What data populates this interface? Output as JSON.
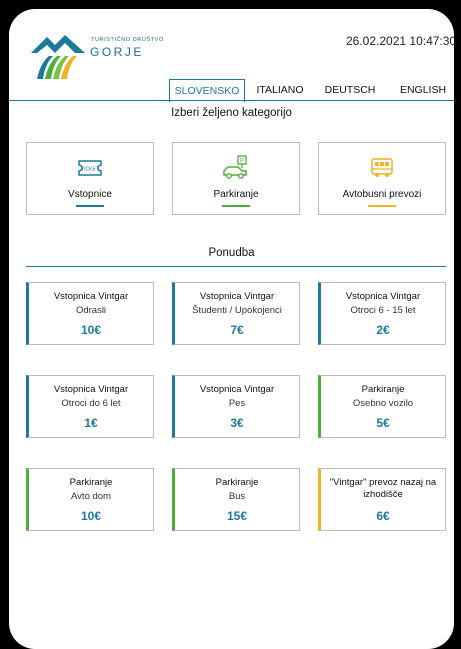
{
  "brand": {
    "small": "TURISTIČNO DRUŠTVO",
    "big": "GORJE"
  },
  "datetime": "26.02.2021  10:47:30",
  "tabs": [
    {
      "label": "SLOVENSKO",
      "active": true
    },
    {
      "label": "ITALIANO",
      "active": false
    },
    {
      "label": "DEUTSCH",
      "active": false
    },
    {
      "label": "ENGLISH",
      "active": false
    }
  ],
  "category_heading": "Izberi željeno kategorijo",
  "categories": [
    {
      "label": "Vstopnice",
      "icon": "ticket-icon",
      "color": "#1e7a99"
    },
    {
      "label": "Parkiranje",
      "icon": "car-parking-icon",
      "color": "#4caf3a"
    },
    {
      "label": "Avtobusni prevozi",
      "icon": "bus-icon",
      "color": "#f0b323"
    }
  ],
  "offers_heading": "Ponudba",
  "offers": [
    {
      "title": "Vstopnica Vintgar",
      "subtitle": "Odrasli",
      "price": "10€",
      "color": "#1e7a99"
    },
    {
      "title": "Vstopnica Vintgar",
      "subtitle": "Študenti / Upokojenci",
      "price": "7€",
      "color": "#1e7a99"
    },
    {
      "title": "Vstopnica Vintgar",
      "subtitle": "Otroci 6 - 15 let",
      "price": "2€",
      "color": "#1e7a99"
    },
    {
      "title": "Vstopnica Vintgar",
      "subtitle": "Otroci do 6 let",
      "price": "1€",
      "color": "#1e7a99"
    },
    {
      "title": "Vstopnica Vintgar",
      "subtitle": "Pes",
      "price": "3€",
      "color": "#1e7a99"
    },
    {
      "title": "Parkiranje",
      "subtitle": "Osebno vozilo",
      "price": "5€",
      "color": "#4caf3a"
    },
    {
      "title": "Parkiranje",
      "subtitle": "Avto dom",
      "price": "10€",
      "color": "#4caf3a"
    },
    {
      "title": "Parkiranje",
      "subtitle": "Bus",
      "price": "15€",
      "color": "#4caf3a"
    },
    {
      "title": "\"Vintgar\" prevoz nazaj na izhodišče",
      "subtitle": "",
      "price": "6€",
      "color": "#f0b323"
    }
  ]
}
